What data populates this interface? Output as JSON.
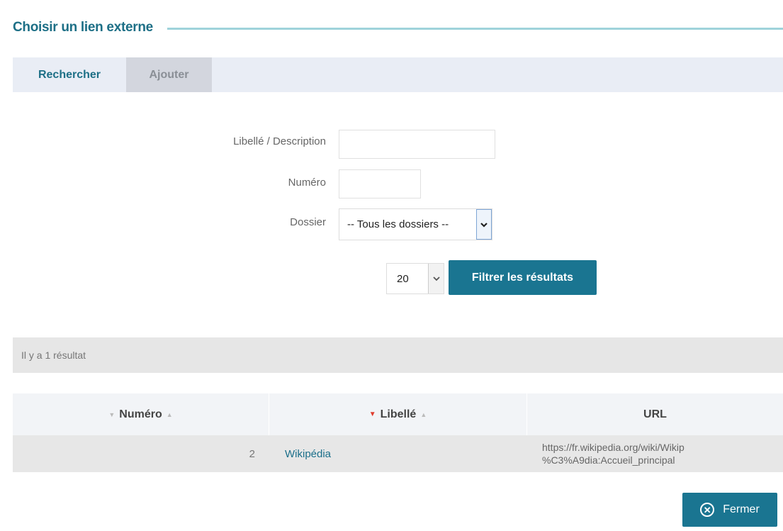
{
  "header": {
    "title": "Choisir un lien externe"
  },
  "tabs": [
    {
      "label": "Rechercher",
      "active": true
    },
    {
      "label": "Ajouter",
      "active": false
    }
  ],
  "form": {
    "description_label": "Libellé / Description",
    "description_value": "",
    "number_label": "Numéro",
    "number_value": "",
    "folder_label": "Dossier",
    "folder_selected": "-- Tous les dossiers --",
    "page_size": "20",
    "filter_button": "Filtrer les résultats"
  },
  "results": {
    "count_text": "Il y a 1 résultat",
    "columns": [
      "Numéro",
      "Libellé",
      "URL"
    ],
    "rows": [
      {
        "numero": "2",
        "libelle": "Wikipédia",
        "url_line1": "https://fr.wikipedia.org/wiki/Wikip",
        "url_line2": "%C3%A9dia:Accueil_principal"
      }
    ]
  },
  "footer": {
    "close_button": "Fermer"
  },
  "colors": {
    "accent": "#1a7591",
    "title": "#1d6f86",
    "sort_active": "#e03c2d"
  }
}
